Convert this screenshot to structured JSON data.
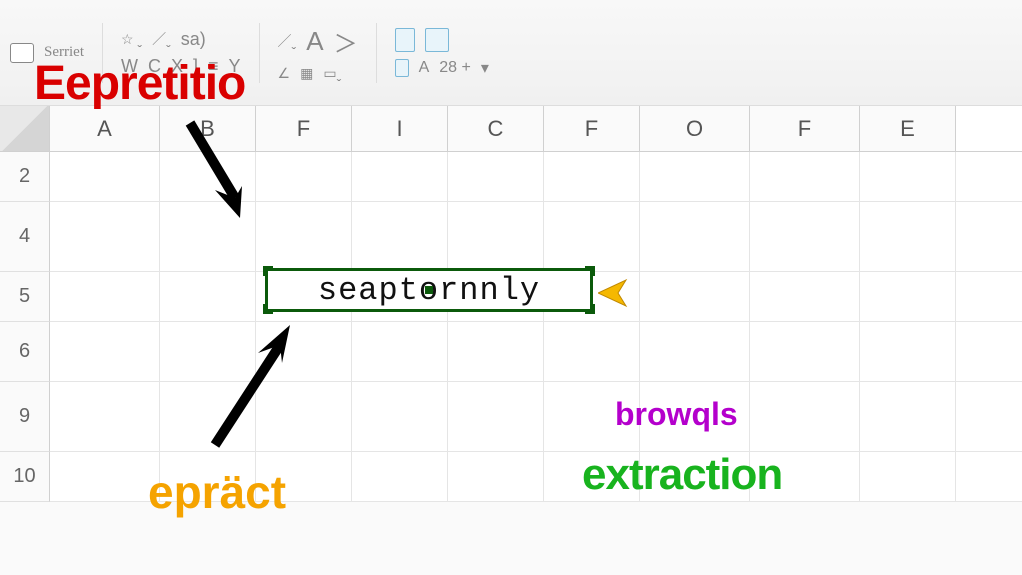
{
  "ribbon": {
    "font_name": "Serriet",
    "row2_letters": [
      "W",
      "C",
      "X",
      "]",
      "≡",
      "Y"
    ],
    "sa_label": "sa)",
    "big_a": "A",
    "zoom_a": "A",
    "zoom_text": "28 +"
  },
  "sheet": {
    "columns": [
      "A",
      "B",
      "F",
      "I",
      "C",
      "F",
      "O",
      "F",
      "E"
    ],
    "rows": [
      "2",
      "4",
      "5",
      "6",
      "9",
      "10"
    ],
    "selected_value": "seaptornnly"
  },
  "annotations": {
    "red": "Eepretitio",
    "orange": "epräct",
    "purple": "browqls",
    "green": "extraction"
  }
}
